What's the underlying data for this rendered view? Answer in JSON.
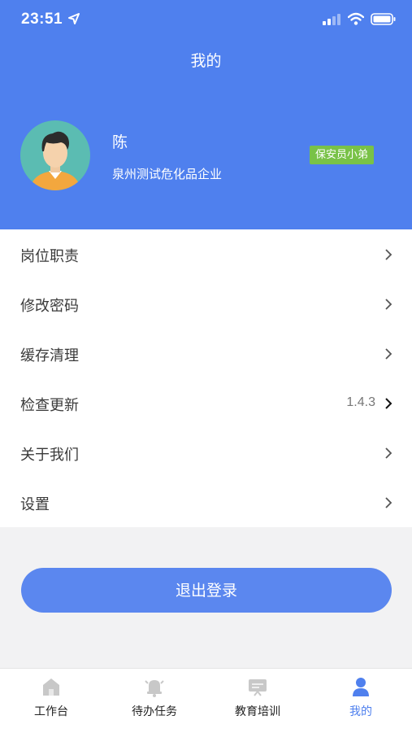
{
  "status_bar": {
    "time": "23:51"
  },
  "header": {
    "title": "我的",
    "user": {
      "name": "陈",
      "company": "泉州测试危化品企业",
      "role": "保安员小弟"
    }
  },
  "menu": [
    {
      "label": "岗位职责",
      "value": ""
    },
    {
      "label": "修改密码",
      "value": ""
    },
    {
      "label": "缓存清理",
      "value": ""
    },
    {
      "label": "检查更新",
      "value": "1.4.3"
    },
    {
      "label": "关于我们",
      "value": ""
    },
    {
      "label": "设置",
      "value": ""
    }
  ],
  "logout_label": "退出登录",
  "tabs": [
    {
      "label": "工作台",
      "icon": "home-icon",
      "active": false
    },
    {
      "label": "待办任务",
      "icon": "bell-icon",
      "active": false
    },
    {
      "label": "教育培训",
      "icon": "presentation-icon",
      "active": false
    },
    {
      "label": "我的",
      "icon": "person-icon",
      "active": true
    }
  ],
  "colors": {
    "primary": "#4f80ee",
    "badge": "#79c247",
    "inactive_icon": "#c8c8c8"
  }
}
